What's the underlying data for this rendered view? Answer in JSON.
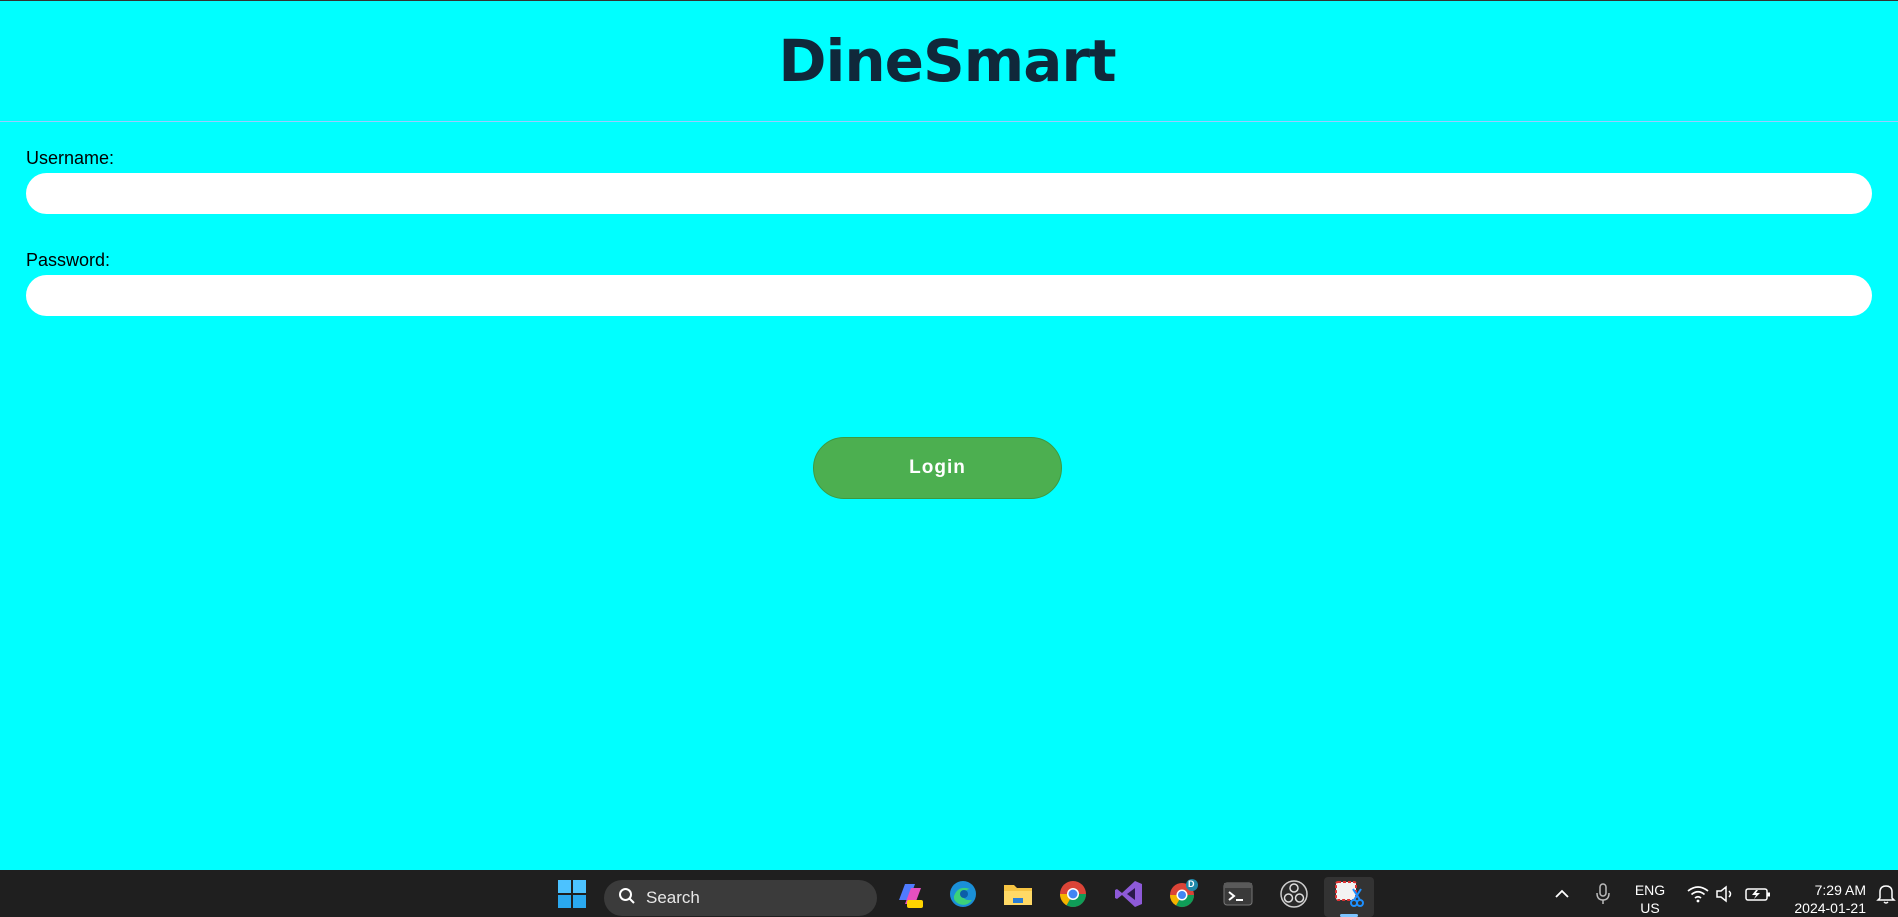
{
  "app": {
    "title": "DineSmart",
    "username_label": "Username:",
    "username_value": "",
    "password_label": "Password:",
    "password_value": "",
    "login_label": "Login",
    "colors": {
      "background": "#00ffff",
      "button": "#4caf50",
      "title": "#10283a"
    }
  },
  "taskbar": {
    "search_placeholder": "Search",
    "apps": [
      "windows-start-icon",
      "copilot-pre-icon",
      "edge-icon",
      "file-explorer-icon",
      "chrome-icon",
      "visual-studio-icon",
      "chrome-profile-icon",
      "terminal-icon",
      "obs-icon",
      "snipping-tool-icon"
    ],
    "chrome_profile_badge": "D",
    "language": "ENG",
    "region": "US",
    "time": "7:29 AM",
    "date": "2024-01-21"
  }
}
